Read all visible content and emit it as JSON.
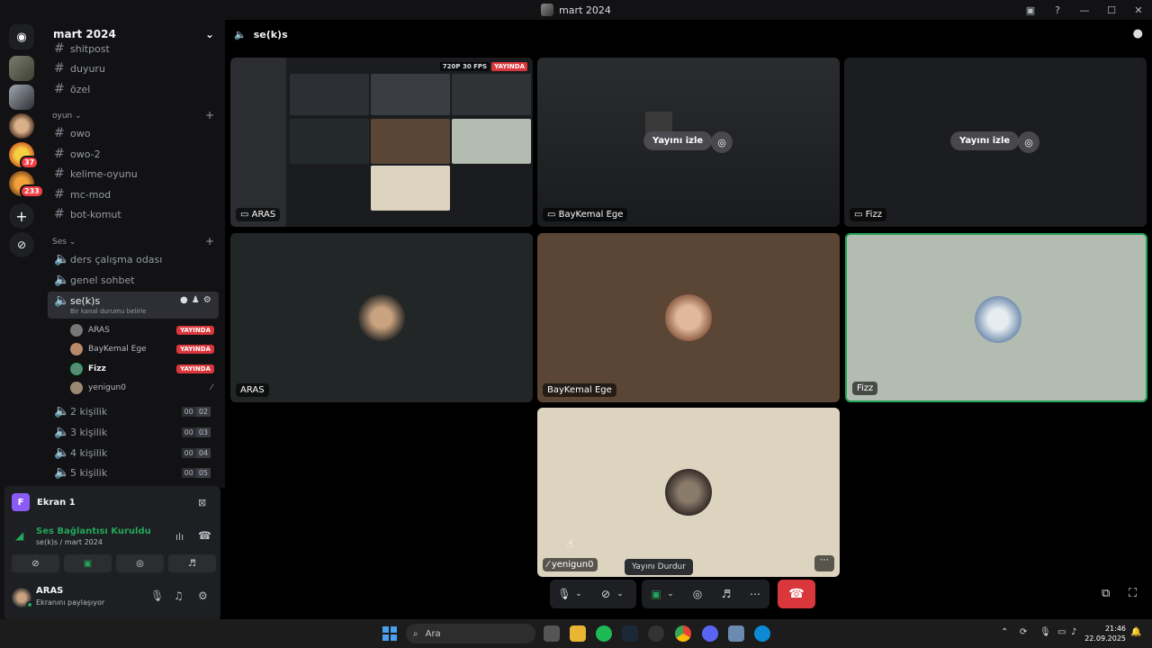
{
  "window": {
    "title": "mart 2024"
  },
  "guild": {
    "name": "mart 2024"
  },
  "channels": {
    "text_top": [
      "shitpost",
      "duyuru",
      "özel"
    ],
    "category_game": "oyun",
    "text_game": [
      "owo",
      "owo-2",
      "kelime-oyunu",
      "mc-mod",
      "bot-komut"
    ],
    "category_voice": "Ses",
    "voice": [
      "ders çalışma odası",
      "genel sohbet"
    ],
    "active_voice": {
      "name": "se(k)s",
      "status": "Bir kanal durumu belirle"
    },
    "voice_users": [
      {
        "name": "ARAS",
        "live": "YAYINDA"
      },
      {
        "name": "BayKemal Ege",
        "live": "YAYINDA"
      },
      {
        "name": "Fizz",
        "live": "YAYINDA"
      },
      {
        "name": "yenigun0",
        "live": ""
      }
    ],
    "voice_more": [
      {
        "name": "2 kişilik",
        "a": "00",
        "b": "02"
      },
      {
        "name": "3 kişilik",
        "a": "00",
        "b": "03"
      },
      {
        "name": "4 kişilik",
        "a": "00",
        "b": "04"
      },
      {
        "name": "5 kişilik",
        "a": "00",
        "b": "05"
      }
    ]
  },
  "server_badges": [
    "37",
    "233"
  ],
  "screen_panel": {
    "title": "Ekran 1",
    "icon_letter": "F",
    "connection": "Ses Bağlantısı Kuruldu",
    "connection_sub": "se(k)s / mart 2024"
  },
  "user": {
    "name": "ARAS",
    "status": "Ekranını paylaşıyor"
  },
  "main": {
    "channel": "se(k)s",
    "stream_quality": "720P 30 FPS",
    "live_label": "YAYINDA",
    "watch_label": "Yayını izle",
    "tiles": [
      "ARAS",
      "BayKemal Ege",
      "Fizz",
      "ARAS",
      "BayKemal Ege",
      "Fizz",
      "yenigun0"
    ],
    "tooltip": "Yayını Durdur"
  },
  "taskbar": {
    "search": "Ara",
    "time": "21:46",
    "date": "22.09.2025"
  },
  "colors": {
    "accent_green": "#23a55a",
    "live_red": "#da373c",
    "brand": "#5865f2"
  }
}
